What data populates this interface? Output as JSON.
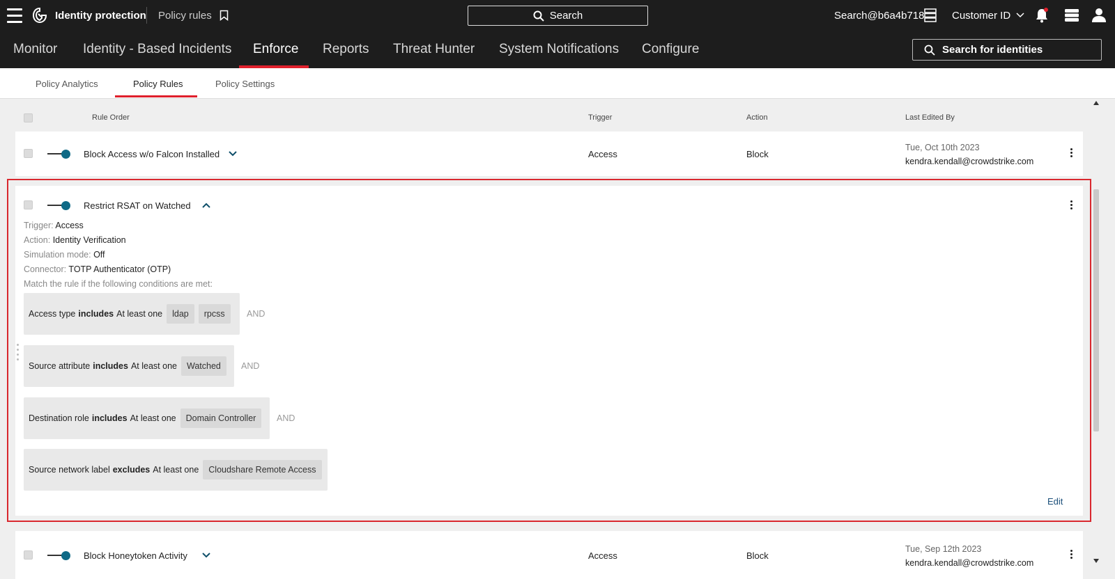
{
  "topbar": {
    "app_title": "Identity protection",
    "page_crumb": "Policy rules",
    "search_label": "Search",
    "user": "Search@b6a4b718",
    "customer": "Customer ID"
  },
  "main_nav": {
    "tabs": [
      "Monitor",
      "Identity - Based Incidents",
      "Enforce",
      "Reports",
      "Threat Hunter",
      "System Notifications",
      "Configure"
    ],
    "active": "Enforce",
    "identity_search": "Search for identities"
  },
  "sub_nav": {
    "tabs": [
      "Policy Analytics",
      "Policy Rules",
      "Policy Settings"
    ],
    "active": "Policy Rules"
  },
  "table": {
    "headers": {
      "rule_order": "Rule Order",
      "trigger": "Trigger",
      "action": "Action",
      "last_edited": "Last Edited By"
    },
    "rows": [
      {
        "name": "Block Access w/o Falcon Installed",
        "trigger": "Access",
        "action": "Block",
        "date": "Tue, Oct 10th 2023",
        "email": "kendra.kendall@crowdstrike.com"
      },
      {
        "name": "Restrict RSAT on Watched",
        "details": {
          "trigger_label": "Trigger:",
          "trigger": "Access",
          "action_label": "Action:",
          "action": "Identity Verification",
          "simulation_label": "Simulation mode:",
          "simulation": "Off",
          "connector_label": "Connector:",
          "connector": "TOTP Authenticator (OTP)",
          "match_text": "Match the rule if the following conditions are met:"
        },
        "conditions": [
          {
            "field": "Access type",
            "op": "includes",
            "qualifier": "At least one",
            "values": [
              "ldap",
              "rpcss"
            ],
            "joiner": "AND"
          },
          {
            "field": "Source attribute",
            "op": "includes",
            "qualifier": "At least one",
            "values": [
              "Watched"
            ],
            "joiner": "AND"
          },
          {
            "field": "Destination role",
            "op": "includes",
            "qualifier": "At least one",
            "values": [
              "Domain Controller"
            ],
            "joiner": "AND"
          },
          {
            "field": "Source network label",
            "op": "excludes",
            "qualifier": "At least one",
            "values": [
              "Cloudshare Remote Access"
            ]
          }
        ],
        "edit_label": "Edit"
      },
      {
        "name": "Block Honeytoken Activity",
        "trigger": "Access",
        "action": "Block",
        "date": "Tue, Sep 12th 2023",
        "email": "kendra.kendall@crowdstrike.com"
      }
    ]
  },
  "colors": {
    "accent_red": "#e0202c",
    "toggle_on": "#0f6a86",
    "highlight": "#d9282f"
  }
}
